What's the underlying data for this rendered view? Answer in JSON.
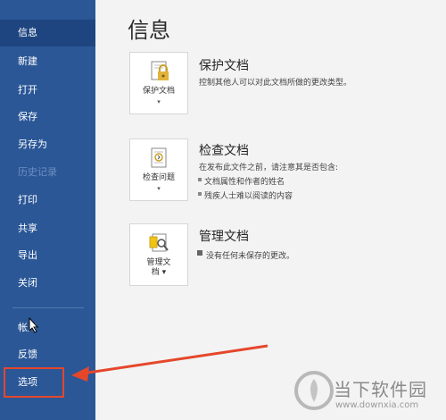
{
  "sidebar": {
    "items": [
      {
        "label": "信息",
        "active": true,
        "disabled": false
      },
      {
        "label": "新建",
        "active": false,
        "disabled": false
      },
      {
        "label": "打开",
        "active": false,
        "disabled": false
      },
      {
        "label": "保存",
        "active": false,
        "disabled": false
      },
      {
        "label": "另存为",
        "active": false,
        "disabled": false
      },
      {
        "label": "历史记录",
        "active": false,
        "disabled": true
      },
      {
        "label": "打印",
        "active": false,
        "disabled": false
      },
      {
        "label": "共享",
        "active": false,
        "disabled": false
      },
      {
        "label": "导出",
        "active": false,
        "disabled": false
      },
      {
        "label": "关闭",
        "active": false,
        "disabled": false
      },
      {
        "label": "帐户",
        "active": false,
        "disabled": false
      },
      {
        "label": "反馈",
        "active": false,
        "disabled": false
      },
      {
        "label": "选项",
        "active": false,
        "disabled": false
      }
    ],
    "bg_color": "#2b5797",
    "highlight_color": "#e5472b"
  },
  "main": {
    "title": "信息",
    "sections": [
      {
        "card_label": "保护文档",
        "icon": "lock-icon",
        "title": "保护文档",
        "description": "控制其他人可以对此文档所做的更改类型。",
        "bullets": []
      },
      {
        "card_label": "检查问题",
        "icon": "inspect-document-icon",
        "title": "检查文档",
        "description": "在发布此文件之前，请注意其是否包含:",
        "bullets": [
          "文档属性和作者的姓名",
          "残疾人士难以阅读的内容"
        ]
      },
      {
        "card_label_line1": "管理文",
        "card_label_line2": "档",
        "icon": "manage-document-icon",
        "title": "管理文档",
        "description": "没有任何未保存的更改。",
        "bullets": []
      }
    ]
  },
  "watermark": {
    "name": "当下软件园",
    "url": "www.downxia.com"
  }
}
